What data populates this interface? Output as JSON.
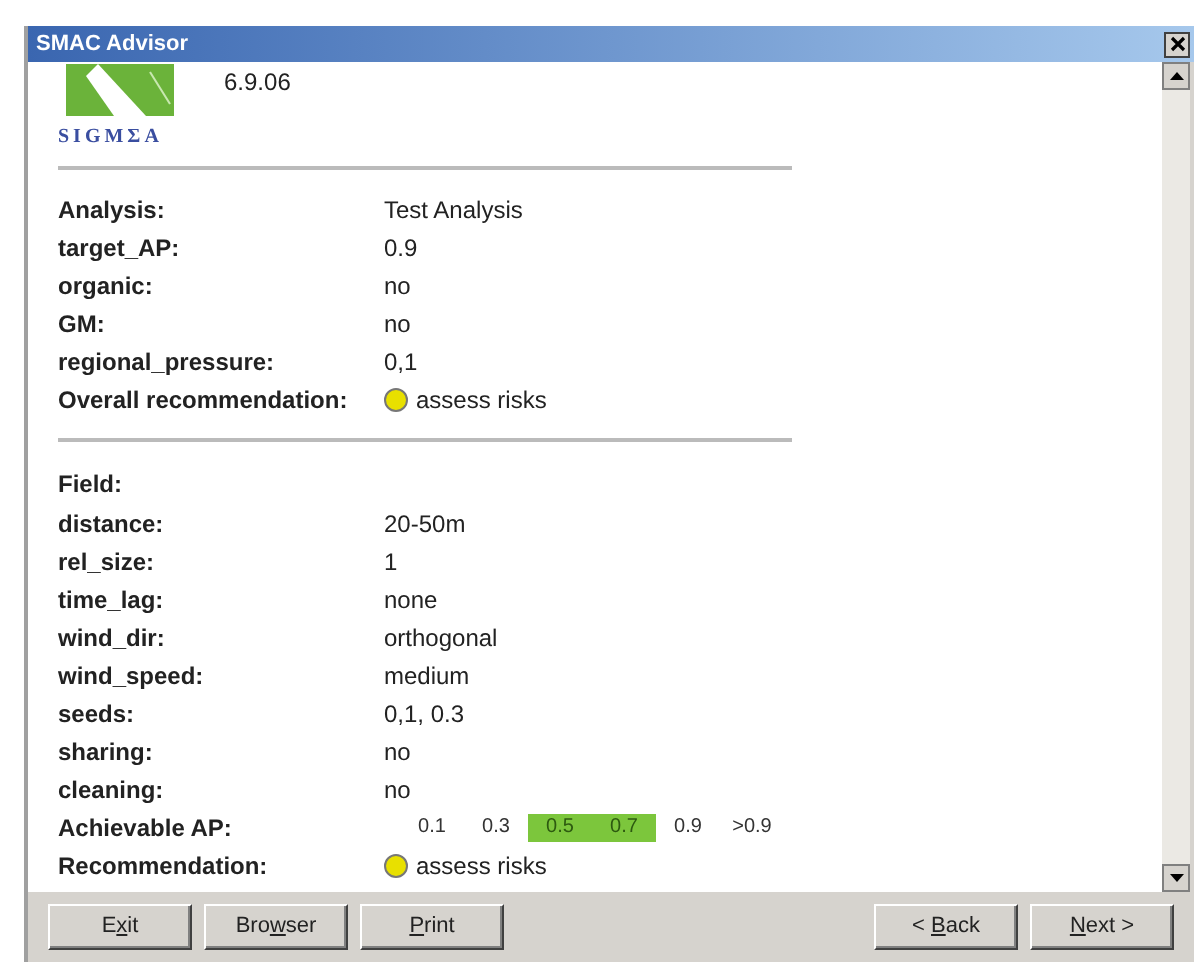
{
  "window": {
    "title": "SMAC Advisor"
  },
  "logo": {
    "text": "SIGMΣA",
    "version": "6.9.06"
  },
  "analysis_rows": [
    {
      "kind": "text",
      "label": "Analysis:",
      "value": "Test Analysis"
    },
    {
      "kind": "text",
      "label": "target_AP:",
      "value": "0.9"
    },
    {
      "kind": "text",
      "label": "organic:",
      "value": "no"
    },
    {
      "kind": "text",
      "label": "GM:",
      "value": "no"
    },
    {
      "kind": "text",
      "label": "regional_pressure:",
      "value": "0,1"
    },
    {
      "kind": "recommendation",
      "label": "Overall recommendation:",
      "value": "assess risks",
      "color": "#e8e000"
    }
  ],
  "field": {
    "heading": "Field:",
    "rows": [
      {
        "kind": "text",
        "label": "distance:",
        "value": "20-50m"
      },
      {
        "kind": "text",
        "label": "rel_size:",
        "value": "1"
      },
      {
        "kind": "text",
        "label": "time_lag:",
        "value": "none"
      },
      {
        "kind": "text",
        "label": "wind_dir:",
        "value": "orthogonal"
      },
      {
        "kind": "text",
        "label": "wind_speed:",
        "value": "medium"
      },
      {
        "kind": "text",
        "label": "seeds:",
        "value": "0,1, 0.3"
      },
      {
        "kind": "text",
        "label": "sharing:",
        "value": "no"
      },
      {
        "kind": "text",
        "label": "cleaning:",
        "value": "no"
      },
      {
        "kind": "scale",
        "label": "Achievable AP:",
        "steps": [
          {
            "label": "0.1",
            "selected": false
          },
          {
            "label": "0.3",
            "selected": false
          },
          {
            "label": "0.5",
            "selected": true
          },
          {
            "label": "0.7",
            "selected": true
          },
          {
            "label": "0.9",
            "selected": false
          },
          {
            "label": ">0.9",
            "selected": false
          }
        ]
      },
      {
        "kind": "recommendation",
        "label": "Recommendation:",
        "value": "assess risks",
        "color": "#e8e000"
      }
    ]
  },
  "buttons_left": [
    {
      "before": "E",
      "mnemonic": "x",
      "after": "it"
    },
    {
      "before": "Bro",
      "mnemonic": "w",
      "after": "ser"
    },
    {
      "mnemonic": "P",
      "after": "rint"
    }
  ],
  "buttons_right": [
    {
      "before": "< ",
      "mnemonic": "B",
      "after": "ack"
    },
    {
      "mnemonic": "N",
      "after": "ext >"
    }
  ]
}
